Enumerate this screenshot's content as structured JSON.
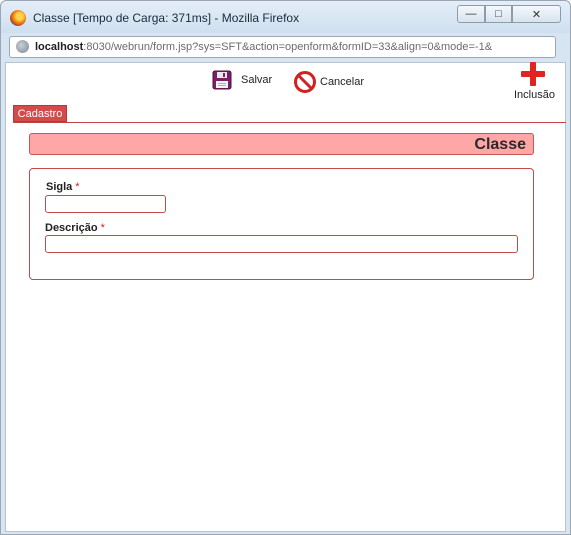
{
  "window": {
    "title": "Classe [Tempo de Carga: 371ms] - Mozilla Firefox",
    "controls": {
      "minimize": "—",
      "maximize": "□",
      "close": "✕"
    }
  },
  "address_bar": {
    "host": "localhost",
    "path": ":8030/webrun/form.jsp?sys=SFT&action=openform&formID=33&align=0&mode=-1&"
  },
  "toolbar": {
    "save_label": "Salvar",
    "cancel_label": "Cancelar",
    "add_label": "Inclusão"
  },
  "tabs": [
    {
      "label": "Cadastro"
    }
  ],
  "form": {
    "heading": "Classe",
    "fields": [
      {
        "label": "Sigla",
        "required_mark": "*",
        "value": ""
      },
      {
        "label": "Descrição",
        "required_mark": "*",
        "value": ""
      }
    ]
  },
  "colors": {
    "accent": "#d34b4b",
    "heading_bg": "#ffa6a6",
    "required": "#d11f1f",
    "add_icon": "#e32222"
  }
}
